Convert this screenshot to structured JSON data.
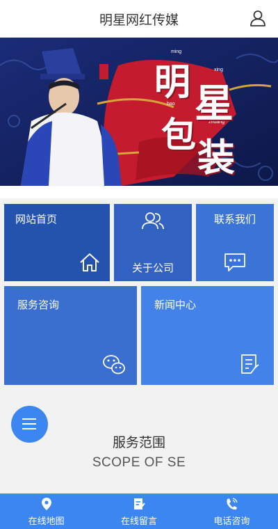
{
  "header": {
    "title": "明星网红传媒",
    "user_icon": "user-icon"
  },
  "banner": {
    "headline_chars": [
      "明",
      "星",
      "包",
      "装"
    ],
    "pinyin": [
      "ming",
      "xing",
      "bao",
      "zhuang"
    ],
    "seal": "明星",
    "colors": {
      "bg": "#12205a",
      "brush": "#c41b2e",
      "gold": "#d6a43a"
    }
  },
  "nav": {
    "tiles": [
      {
        "label": "网站首页",
        "icon": "home-icon",
        "color": "#2453ae"
      },
      {
        "label": "关于公司",
        "icon": "users-icon",
        "color": "#3363c2"
      },
      {
        "label": "联系我们",
        "icon": "chat-bubble-icon",
        "color": "#3b74d6"
      },
      {
        "label": "服务咨询",
        "icon": "wechat-icon",
        "color": "#3a6fd0"
      },
      {
        "label": "新闻中心",
        "icon": "document-edit-icon",
        "color": "#4382e8"
      }
    ]
  },
  "section": {
    "title": "服务范围",
    "subtitle": "SCOPE OF SE",
    "menu_icon": "hamburger-menu-icon"
  },
  "footer": {
    "color": "#3b86f0",
    "items": [
      {
        "label": "在线地图",
        "icon": "map-pin-icon"
      },
      {
        "label": "在线留言",
        "icon": "message-edit-icon"
      },
      {
        "label": "电话咨询",
        "icon": "phone-icon"
      }
    ]
  }
}
